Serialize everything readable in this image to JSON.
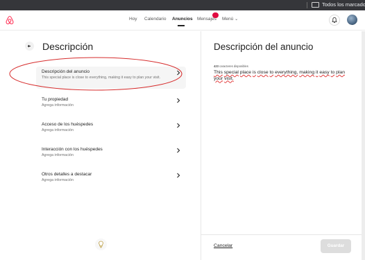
{
  "browser": {
    "bookmarks_label": "Todos los marcadores",
    "folder_icon": "folder-icon"
  },
  "header": {
    "logo_icon": "airbnb-logo-icon",
    "nav": [
      {
        "label": "Hoy"
      },
      {
        "label": "Calendario"
      },
      {
        "label": "Anuncios"
      },
      {
        "label": "Mensajes"
      },
      {
        "label": "Menú"
      }
    ],
    "active_nav": "Anuncios",
    "messages_badge": "",
    "bell_icon": "bell-icon",
    "avatar_icon": "avatar-icon"
  },
  "left": {
    "title": "Descripción",
    "back_icon": "arrow-left-icon",
    "rows": [
      {
        "title": "Descripción del anuncio",
        "subtitle": "This special place is close to everything, making it easy to plan your visit."
      },
      {
        "title": "Tu propiedad",
        "subtitle": "Agrega información"
      },
      {
        "title": "Acceso de los huéspedes",
        "subtitle": "Agrega información"
      },
      {
        "title": "Interacción con los huéspedes",
        "subtitle": "Agrega información"
      },
      {
        "title": "Otros detalles a destacar",
        "subtitle": "Agrega información"
      }
    ],
    "selected_row": 0,
    "tip_icon": "lightbulb-icon"
  },
  "right": {
    "title": "Descripción del anuncio",
    "chars_count": "423",
    "chars_label": "caracteres disponibles",
    "text_words": [
      "This",
      "special",
      "place",
      "is",
      "close",
      "to",
      "everything,",
      "making",
      "it",
      "easy",
      "to",
      "plan",
      "your",
      "visit."
    ],
    "cancel_label": "Cancelar",
    "save_label": "Guardar"
  },
  "colors": {
    "brand": "#ff385c",
    "badge": "#e00b41",
    "annotation": "#d62b2b",
    "save_disabled": "#dddddd"
  }
}
